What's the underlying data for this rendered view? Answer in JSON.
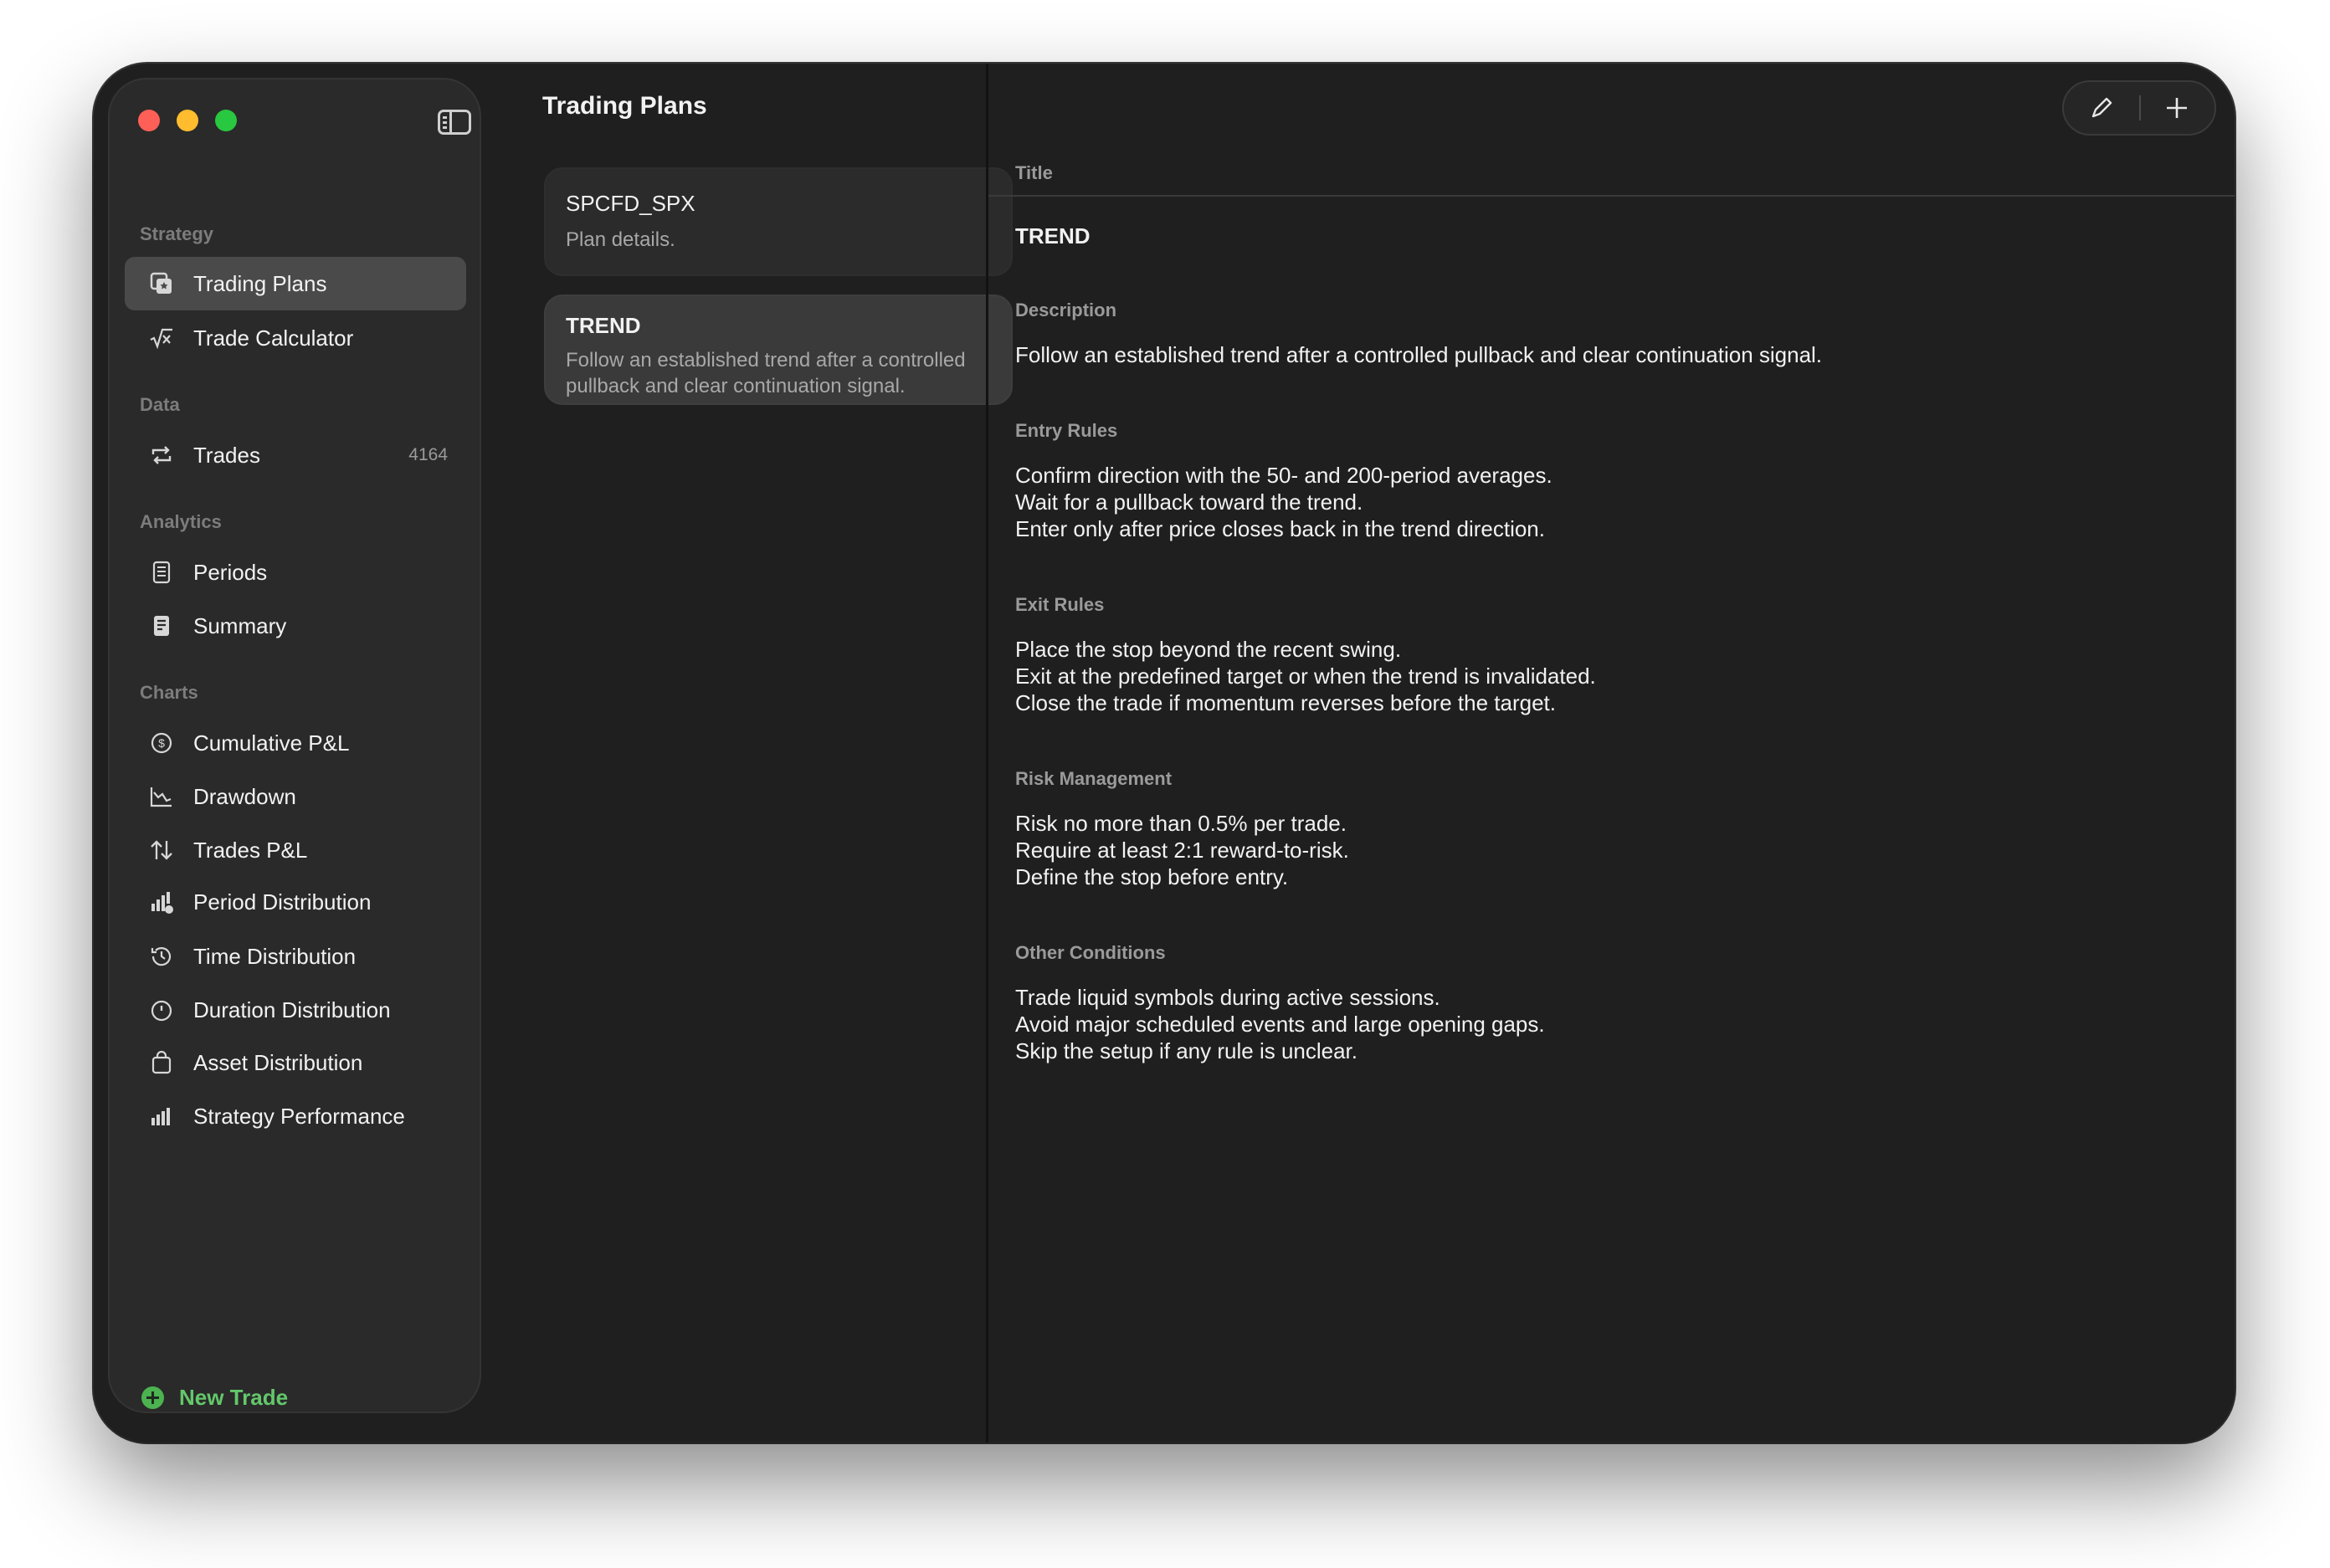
{
  "sidebar": {
    "sections": {
      "strategy": "Strategy",
      "data": "Data",
      "analytics": "Analytics",
      "charts": "Charts"
    },
    "items": {
      "trading_plans": "Trading Plans",
      "trade_calculator": "Trade Calculator",
      "trades": "Trades",
      "trades_count": "4164",
      "periods": "Periods",
      "summary": "Summary",
      "cumulative_pnl": "Cumulative P&L",
      "drawdown": "Drawdown",
      "trades_pnl": "Trades P&L",
      "period_distribution": "Period Distribution",
      "time_distribution": "Time Distribution",
      "duration_distribution": "Duration Distribution",
      "asset_distribution": "Asset Distribution",
      "strategy_performance": "Strategy Performance"
    },
    "new_trade": "New Trade"
  },
  "list": {
    "title": "Trading Plans",
    "plans": [
      {
        "name": "SPCFD_SPX",
        "desc": "Plan details."
      },
      {
        "name": "TREND",
        "desc": "Follow an established trend after a controlled pullback and clear continuation signal."
      }
    ]
  },
  "detail": {
    "title_label": "Title",
    "title_value": "TREND",
    "description_label": "Description",
    "description_value": "Follow an established trend after a controlled pullback and clear continuation signal.",
    "entry_label": "Entry Rules",
    "entry_lines": [
      "Confirm direction with the 50- and 200-period averages.",
      "Wait for a pullback toward the trend.",
      "Enter only after price closes back in the trend direction."
    ],
    "exit_label": "Exit Rules",
    "exit_lines": [
      "Place the stop beyond the recent swing.",
      "Exit at the predefined target or when the trend is invalidated.",
      "Close the trade if momentum reverses before the target."
    ],
    "risk_label": "Risk Management",
    "risk_lines": [
      "Risk no more than 0.5% per trade.",
      "Require at least 2:1 reward-to-risk.",
      "Define the stop before entry."
    ],
    "other_label": "Other Conditions",
    "other_lines": [
      "Trade liquid symbols during active sessions.",
      "Avoid major scheduled events and large opening gaps.",
      "Skip the setup if any rule is unclear."
    ]
  },
  "colors": {
    "window_bg": "#1f1f1f",
    "sidebar_bg": "#2a2a2a",
    "selected_bg": "#4a4a4a",
    "accent_green": "#63c86a"
  }
}
